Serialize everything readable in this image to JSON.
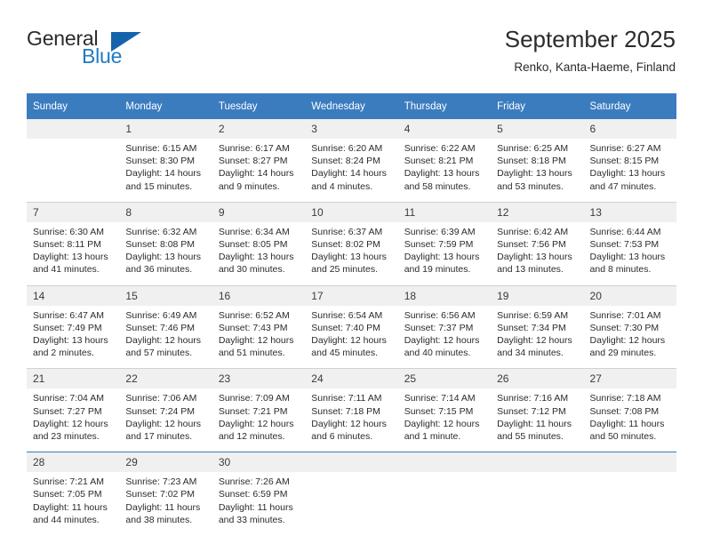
{
  "brand": {
    "word_one": "General",
    "word_two": "Blue",
    "triangle_icon": "triangle-right-icon",
    "accent_color": "#1f7ac4",
    "triangle_color": "#1464ac"
  },
  "header": {
    "title": "September 2025",
    "subtitle": "Renko, Kanta-Haeme, Finland"
  },
  "colors": {
    "header_row_bg": "#3b7cbf",
    "header_row_text": "#ffffff",
    "daynum_bg": "#f0f0f0",
    "cell_bg": "#ffffff",
    "grid_line": "#c8d4e0",
    "bottom_rule": "#3b7cbf"
  },
  "labels": {
    "sunrise_prefix": "Sunrise:",
    "sunset_prefix": "Sunset:",
    "daylight_prefix": "Daylight:"
  },
  "weekday_headers": [
    "Sunday",
    "Monday",
    "Tuesday",
    "Wednesday",
    "Thursday",
    "Friday",
    "Saturday"
  ],
  "weeks": [
    [
      {
        "day": "",
        "sunrise": "",
        "sunset": "",
        "daylight": ""
      },
      {
        "day": "1",
        "sunrise": "Sunrise: 6:15 AM",
        "sunset": "Sunset: 8:30 PM",
        "daylight": "Daylight: 14 hours and 15 minutes."
      },
      {
        "day": "2",
        "sunrise": "Sunrise: 6:17 AM",
        "sunset": "Sunset: 8:27 PM",
        "daylight": "Daylight: 14 hours and 9 minutes."
      },
      {
        "day": "3",
        "sunrise": "Sunrise: 6:20 AM",
        "sunset": "Sunset: 8:24 PM",
        "daylight": "Daylight: 14 hours and 4 minutes."
      },
      {
        "day": "4",
        "sunrise": "Sunrise: 6:22 AM",
        "sunset": "Sunset: 8:21 PM",
        "daylight": "Daylight: 13 hours and 58 minutes."
      },
      {
        "day": "5",
        "sunrise": "Sunrise: 6:25 AM",
        "sunset": "Sunset: 8:18 PM",
        "daylight": "Daylight: 13 hours and 53 minutes."
      },
      {
        "day": "6",
        "sunrise": "Sunrise: 6:27 AM",
        "sunset": "Sunset: 8:15 PM",
        "daylight": "Daylight: 13 hours and 47 minutes."
      }
    ],
    [
      {
        "day": "7",
        "sunrise": "Sunrise: 6:30 AM",
        "sunset": "Sunset: 8:11 PM",
        "daylight": "Daylight: 13 hours and 41 minutes."
      },
      {
        "day": "8",
        "sunrise": "Sunrise: 6:32 AM",
        "sunset": "Sunset: 8:08 PM",
        "daylight": "Daylight: 13 hours and 36 minutes."
      },
      {
        "day": "9",
        "sunrise": "Sunrise: 6:34 AM",
        "sunset": "Sunset: 8:05 PM",
        "daylight": "Daylight: 13 hours and 30 minutes."
      },
      {
        "day": "10",
        "sunrise": "Sunrise: 6:37 AM",
        "sunset": "Sunset: 8:02 PM",
        "daylight": "Daylight: 13 hours and 25 minutes."
      },
      {
        "day": "11",
        "sunrise": "Sunrise: 6:39 AM",
        "sunset": "Sunset: 7:59 PM",
        "daylight": "Daylight: 13 hours and 19 minutes."
      },
      {
        "day": "12",
        "sunrise": "Sunrise: 6:42 AM",
        "sunset": "Sunset: 7:56 PM",
        "daylight": "Daylight: 13 hours and 13 minutes."
      },
      {
        "day": "13",
        "sunrise": "Sunrise: 6:44 AM",
        "sunset": "Sunset: 7:53 PM",
        "daylight": "Daylight: 13 hours and 8 minutes."
      }
    ],
    [
      {
        "day": "14",
        "sunrise": "Sunrise: 6:47 AM",
        "sunset": "Sunset: 7:49 PM",
        "daylight": "Daylight: 13 hours and 2 minutes."
      },
      {
        "day": "15",
        "sunrise": "Sunrise: 6:49 AM",
        "sunset": "Sunset: 7:46 PM",
        "daylight": "Daylight: 12 hours and 57 minutes."
      },
      {
        "day": "16",
        "sunrise": "Sunrise: 6:52 AM",
        "sunset": "Sunset: 7:43 PM",
        "daylight": "Daylight: 12 hours and 51 minutes."
      },
      {
        "day": "17",
        "sunrise": "Sunrise: 6:54 AM",
        "sunset": "Sunset: 7:40 PM",
        "daylight": "Daylight: 12 hours and 45 minutes."
      },
      {
        "day": "18",
        "sunrise": "Sunrise: 6:56 AM",
        "sunset": "Sunset: 7:37 PM",
        "daylight": "Daylight: 12 hours and 40 minutes."
      },
      {
        "day": "19",
        "sunrise": "Sunrise: 6:59 AM",
        "sunset": "Sunset: 7:34 PM",
        "daylight": "Daylight: 12 hours and 34 minutes."
      },
      {
        "day": "20",
        "sunrise": "Sunrise: 7:01 AM",
        "sunset": "Sunset: 7:30 PM",
        "daylight": "Daylight: 12 hours and 29 minutes."
      }
    ],
    [
      {
        "day": "21",
        "sunrise": "Sunrise: 7:04 AM",
        "sunset": "Sunset: 7:27 PM",
        "daylight": "Daylight: 12 hours and 23 minutes."
      },
      {
        "day": "22",
        "sunrise": "Sunrise: 7:06 AM",
        "sunset": "Sunset: 7:24 PM",
        "daylight": "Daylight: 12 hours and 17 minutes."
      },
      {
        "day": "23",
        "sunrise": "Sunrise: 7:09 AM",
        "sunset": "Sunset: 7:21 PM",
        "daylight": "Daylight: 12 hours and 12 minutes."
      },
      {
        "day": "24",
        "sunrise": "Sunrise: 7:11 AM",
        "sunset": "Sunset: 7:18 PM",
        "daylight": "Daylight: 12 hours and 6 minutes."
      },
      {
        "day": "25",
        "sunrise": "Sunrise: 7:14 AM",
        "sunset": "Sunset: 7:15 PM",
        "daylight": "Daylight: 12 hours and 1 minute."
      },
      {
        "day": "26",
        "sunrise": "Sunrise: 7:16 AM",
        "sunset": "Sunset: 7:12 PM",
        "daylight": "Daylight: 11 hours and 55 minutes."
      },
      {
        "day": "27",
        "sunrise": "Sunrise: 7:18 AM",
        "sunset": "Sunset: 7:08 PM",
        "daylight": "Daylight: 11 hours and 50 minutes."
      }
    ],
    [
      {
        "day": "28",
        "sunrise": "Sunrise: 7:21 AM",
        "sunset": "Sunset: 7:05 PM",
        "daylight": "Daylight: 11 hours and 44 minutes."
      },
      {
        "day": "29",
        "sunrise": "Sunrise: 7:23 AM",
        "sunset": "Sunset: 7:02 PM",
        "daylight": "Daylight: 11 hours and 38 minutes."
      },
      {
        "day": "30",
        "sunrise": "Sunrise: 7:26 AM",
        "sunset": "Sunset: 6:59 PM",
        "daylight": "Daylight: 11 hours and 33 minutes."
      },
      {
        "day": "",
        "sunrise": "",
        "sunset": "",
        "daylight": ""
      },
      {
        "day": "",
        "sunrise": "",
        "sunset": "",
        "daylight": ""
      },
      {
        "day": "",
        "sunrise": "",
        "sunset": "",
        "daylight": ""
      },
      {
        "day": "",
        "sunrise": "",
        "sunset": "",
        "daylight": ""
      }
    ]
  ]
}
